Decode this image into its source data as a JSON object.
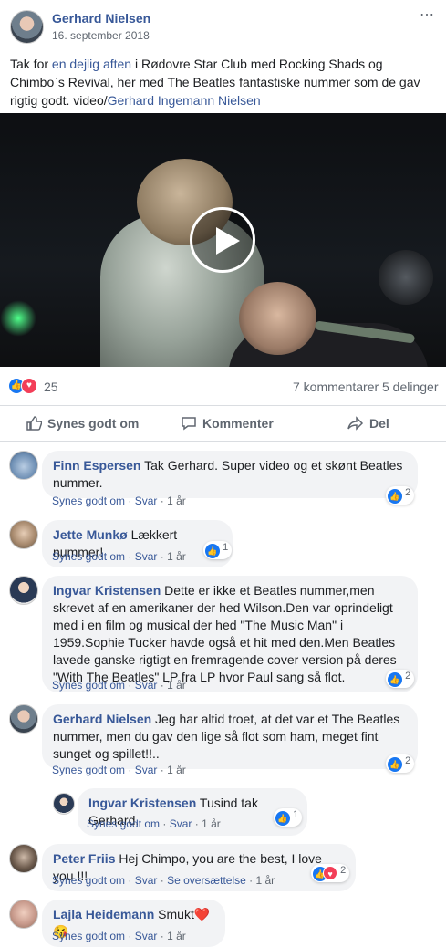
{
  "post": {
    "author": "Gerhard Nielsen",
    "date": "16. september 2018",
    "more_icon": "⋯",
    "text_1": "Tak for ",
    "text_link_1": "en dejlig aften",
    "text_2": " i Rødovre Star Club med Rocking Shads og Chimbo`s Revival, her med The Beatles fantastiske nummer som de gav rigtig godt. video/",
    "text_link_2": "Gerhard Ingemann Nielsen"
  },
  "stats": {
    "reactions_count": "25",
    "comments_count": "7 kommentarer",
    "shares_count": "5 delinger"
  },
  "actions": {
    "like": "Synes godt om",
    "comment": "Kommenter",
    "share": "Del"
  },
  "comments": [
    {
      "name": "Finn Espersen",
      "text": "Tak Gerhard. Super video og et skønt Beatles nummer.",
      "like": "Synes godt om",
      "reply": "Svar",
      "time": "1 år",
      "count": "2"
    },
    {
      "name": "Jette Munkø",
      "text": "Lækkert nummer!",
      "like": "Synes godt om",
      "reply": "Svar",
      "time": "1 år",
      "count": "1"
    },
    {
      "name": "Ingvar Kristensen",
      "text": "Dette er ikke et Beatles nummer,men skrevet af en amerikaner der hed Wilson.Den var oprindeligt med i en film og musical der hed \"The Music Man\" i 1959.Sophie Tucker havde også et hit med den.Men Beatles lavede ganske rigtigt en fremragende cover version på deres \"With The Beatles\" LP fra LP hvor Paul sang så flot.",
      "like": "Synes godt om",
      "reply": "Svar",
      "time": "1 år",
      "count": "2"
    },
    {
      "name": "Gerhard Nielsen",
      "text": "Jeg har altid troet, at det var et The Beatles nummer, men du gav den lige så flot som ham, meget fint sunget og spillet!!..",
      "like": "Synes godt om",
      "reply": "Svar",
      "time": "1 år",
      "count": "2"
    },
    {
      "name": "Ingvar Kristensen",
      "text": "Tusind tak Gerhard.",
      "like": "Synes godt om",
      "reply": "Svar",
      "time": "1 år",
      "count": "1"
    },
    {
      "name": "Peter Friis",
      "text": "Hej Chimpo, you are the best, I love you !!!",
      "like": "Synes godt om",
      "reply": "Svar",
      "translate": "Se oversættelse",
      "time": "1 år",
      "count": "2"
    },
    {
      "name": "Lajla Heidemann",
      "text": "Smukt❤️😘",
      "like": "Synes godt om",
      "reply": "Svar",
      "time": "1 år"
    }
  ],
  "colors": {
    "link": "#385898",
    "like": "#1877f2",
    "love": "#f33e58",
    "muted": "#606770"
  }
}
